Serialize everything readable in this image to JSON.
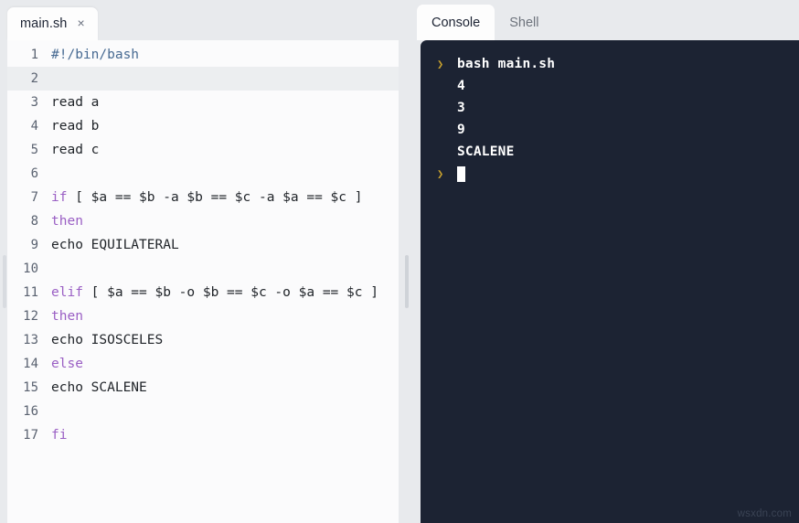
{
  "editor": {
    "tab": {
      "filename": "main.sh",
      "close_icon": "×"
    },
    "active_line": 2,
    "lines": [
      {
        "number": "1",
        "text": "#!/bin/bash",
        "style": "comment"
      },
      {
        "number": "2",
        "text": "",
        "style": "plain"
      },
      {
        "number": "3",
        "text": "read a",
        "style": "plain"
      },
      {
        "number": "4",
        "text": "read b",
        "style": "plain"
      },
      {
        "number": "5",
        "text": "read c",
        "style": "plain"
      },
      {
        "number": "6",
        "text": "",
        "style": "plain"
      },
      {
        "number": "7",
        "keyword": "if",
        "text": " [ $a == $b -a $b == $c -a $a == $c ]",
        "style": "keyword-lead"
      },
      {
        "number": "8",
        "text": "then",
        "style": "keyword"
      },
      {
        "number": "9",
        "text": "echo EQUILATERAL",
        "style": "plain"
      },
      {
        "number": "10",
        "text": "",
        "style": "plain"
      },
      {
        "number": "11",
        "keyword": "elif",
        "text": " [ $a == $b -o $b == $c -o $a == $c ]",
        "style": "keyword-lead"
      },
      {
        "number": "12",
        "text": "then",
        "style": "keyword"
      },
      {
        "number": "13",
        "text": "echo ISOSCELES",
        "style": "plain"
      },
      {
        "number": "14",
        "text": "else",
        "style": "keyword"
      },
      {
        "number": "15",
        "text": "echo SCALENE",
        "style": "plain"
      },
      {
        "number": "16",
        "text": "",
        "style": "plain"
      },
      {
        "number": "17",
        "text": "fi",
        "style": "keyword"
      }
    ]
  },
  "console": {
    "tabs": [
      {
        "label": "Console",
        "active": true
      },
      {
        "label": "Shell",
        "active": false
      }
    ],
    "prompt_glyph": "❯",
    "lines": [
      {
        "prompt": true,
        "text": "bash main.sh",
        "cursor": false
      },
      {
        "prompt": false,
        "text": "4",
        "cursor": false
      },
      {
        "prompt": false,
        "text": "3",
        "cursor": false
      },
      {
        "prompt": false,
        "text": "9",
        "cursor": false
      },
      {
        "prompt": false,
        "text": "SCALENE",
        "cursor": false
      },
      {
        "prompt": true,
        "text": "",
        "cursor": true
      }
    ]
  },
  "watermark": {
    "text": "wsxdn.com"
  },
  "colors": {
    "tabbar_bg": "#e8eaed",
    "editor_bg": "#fbfbfc",
    "console_bg": "#1c2333",
    "keyword": "#9a5fc4",
    "comment": "#476a92",
    "code_text": "#1f2328",
    "line_number": "#5a6270",
    "prompt": "#c7a02e",
    "console_text": "#ffffff"
  }
}
